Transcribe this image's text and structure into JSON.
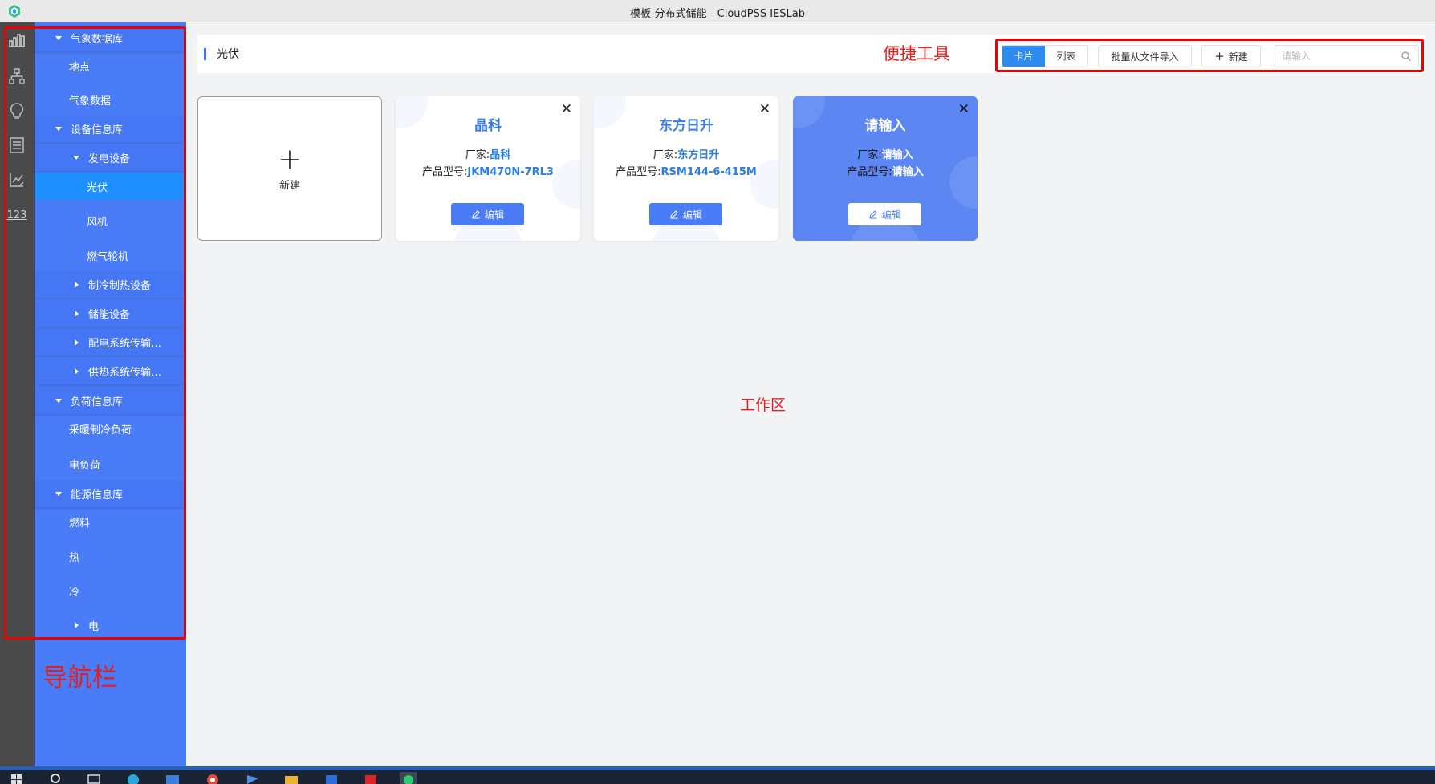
{
  "window": {
    "title": "模板-分布式储能 - CloudPSS IESLab"
  },
  "rail": {
    "icons": [
      "bar-chart-icon",
      "hierarchy-icon",
      "lightbulb-icon",
      "list-doc-icon",
      "chart-edit-icon",
      "number-icon"
    ],
    "number_label": "123"
  },
  "sidebar": {
    "weather_db": "气象数据库",
    "location": "地点",
    "weather_data": "气象数据",
    "device_db": "设备信息库",
    "gen_equipment": "发电设备",
    "pv": "光伏",
    "wind": "风机",
    "gas_turbine": "燃气轮机",
    "cooling_heating": "制冷制热设备",
    "storage": "储能设备",
    "power_dist": "配电系统传输…",
    "heat_supply": "供热系统传输…",
    "load_db": "负荷信息库",
    "hvac_load": "采暖制冷负荷",
    "electric_load": "电负荷",
    "energy_db": "能源信息库",
    "fuel": "燃料",
    "heat": "热",
    "cold": "冷",
    "electricity": "电"
  },
  "header": {
    "title": "光伏"
  },
  "toolbar": {
    "card_view": "卡片",
    "list_view": "列表",
    "batch_import": "批量从文件导入",
    "new_label": "新建",
    "search_placeholder": "请输入"
  },
  "annotations": {
    "tools": "便捷工具",
    "workarea": "工作区",
    "navbar": "导航栏"
  },
  "new_card": {
    "label": "新建"
  },
  "cards": [
    {
      "title": "晶科",
      "vendor_label": "厂家:",
      "vendor": "晶科",
      "model_label": "产品型号:",
      "model": "JKM470N-7RL3",
      "edit": "编辑",
      "style": "white"
    },
    {
      "title": "东方日升",
      "vendor_label": "厂家:",
      "vendor": "东方日升",
      "model_label": "产品型号:",
      "model": "RSM144-6-415M",
      "edit": "编辑",
      "style": "white"
    },
    {
      "title": "请输入",
      "vendor_label": "厂家:",
      "vendor": "请输入",
      "model_label": "产品型号:",
      "model": "请输入",
      "edit": "编辑",
      "style": "blue"
    }
  ],
  "colors": {
    "sidebar": "#4a7cf7",
    "selected": "#1e90ff",
    "accent": "#2d8cf0",
    "annotation": "#e00000",
    "rail": "#4a4a4a"
  }
}
